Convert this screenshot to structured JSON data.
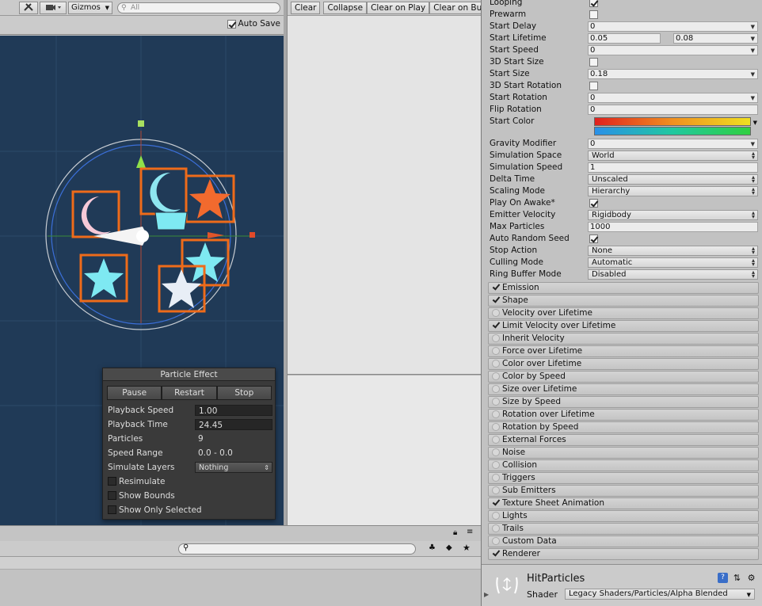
{
  "scene": {
    "toolbar": {
      "gizmos_label": "Gizmos",
      "search_placeholder": "All"
    },
    "autosave_label": "Auto Save"
  },
  "particle_effect": {
    "title": "Particle Effect",
    "buttons": {
      "pause": "Pause",
      "restart": "Restart",
      "stop": "Stop"
    },
    "rows": {
      "playback_speed": {
        "label": "Playback Speed",
        "value": "1.00"
      },
      "playback_time": {
        "label": "Playback Time",
        "value": "24.45"
      },
      "particles": {
        "label": "Particles",
        "value": "9"
      },
      "speed_range": {
        "label": "Speed Range",
        "value": "0.0 - 0.0"
      },
      "simulate_layers": {
        "label": "Simulate Layers",
        "value": "Nothing"
      }
    },
    "toggles": {
      "resimulate": "Resimulate",
      "show_bounds": "Show Bounds",
      "show_only_selected": "Show Only Selected"
    }
  },
  "console": {
    "buttons": {
      "clear": "Clear",
      "collapse": "Collapse",
      "clear_on_play": "Clear on Play",
      "clear_on_build": "Clear on Bu"
    }
  },
  "inspector": {
    "main": {
      "looping": "Looping",
      "prewarm": "Prewarm",
      "start_delay": {
        "label": "Start Delay",
        "value": "0"
      },
      "start_lifetime": {
        "label": "Start Lifetime",
        "min": "0.05",
        "max": "0.08"
      },
      "start_speed": {
        "label": "Start Speed",
        "value": "0"
      },
      "start_size_3d": "3D Start Size",
      "start_size": {
        "label": "Start Size",
        "value": "0.18"
      },
      "start_rotation_3d": "3D Start Rotation",
      "start_rotation": {
        "label": "Start Rotation",
        "value": "0"
      },
      "flip_rotation": {
        "label": "Flip Rotation",
        "value": "0"
      },
      "start_color": "Start Color",
      "gravity_modifier": {
        "label": "Gravity Modifier",
        "value": "0"
      },
      "simulation_space": {
        "label": "Simulation Space",
        "value": "World"
      },
      "simulation_speed": {
        "label": "Simulation Speed",
        "value": "1"
      },
      "delta_time": {
        "label": "Delta Time",
        "value": "Unscaled"
      },
      "scaling_mode": {
        "label": "Scaling Mode",
        "value": "Hierarchy"
      },
      "play_on_awake": "Play On Awake*",
      "emitter_velocity": {
        "label": "Emitter Velocity",
        "value": "Rigidbody"
      },
      "max_particles": {
        "label": "Max Particles",
        "value": "1000"
      },
      "auto_random_seed": "Auto Random Seed",
      "stop_action": {
        "label": "Stop Action",
        "value": "None"
      },
      "culling_mode": {
        "label": "Culling Mode",
        "value": "Automatic"
      },
      "ring_buffer_mode": {
        "label": "Ring Buffer Mode",
        "value": "Disabled"
      }
    },
    "modules": [
      {
        "label": "Emission",
        "enabled": true
      },
      {
        "label": "Shape",
        "enabled": true
      },
      {
        "label": "Velocity over Lifetime",
        "enabled": false
      },
      {
        "label": "Limit Velocity over Lifetime",
        "enabled": true
      },
      {
        "label": "Inherit Velocity",
        "enabled": false
      },
      {
        "label": "Force over Lifetime",
        "enabled": false
      },
      {
        "label": "Color over Lifetime",
        "enabled": false
      },
      {
        "label": "Color by Speed",
        "enabled": false
      },
      {
        "label": "Size over Lifetime",
        "enabled": false
      },
      {
        "label": "Size by Speed",
        "enabled": false
      },
      {
        "label": "Rotation over Lifetime",
        "enabled": false
      },
      {
        "label": "Rotation by Speed",
        "enabled": false
      },
      {
        "label": "External Forces",
        "enabled": false
      },
      {
        "label": "Noise",
        "enabled": false
      },
      {
        "label": "Collision",
        "enabled": false
      },
      {
        "label": "Triggers",
        "enabled": false
      },
      {
        "label": "Sub Emitters",
        "enabled": false
      },
      {
        "label": "Texture Sheet Animation",
        "enabled": true
      },
      {
        "label": "Lights",
        "enabled": false
      },
      {
        "label": "Trails",
        "enabled": false
      },
      {
        "label": "Custom Data",
        "enabled": false
      },
      {
        "label": "Renderer",
        "enabled": true
      }
    ],
    "material": {
      "name": "HitParticles",
      "shader_label": "Shader",
      "shader_value": "Legacy Shaders/Particles/Alpha Blended"
    }
  }
}
